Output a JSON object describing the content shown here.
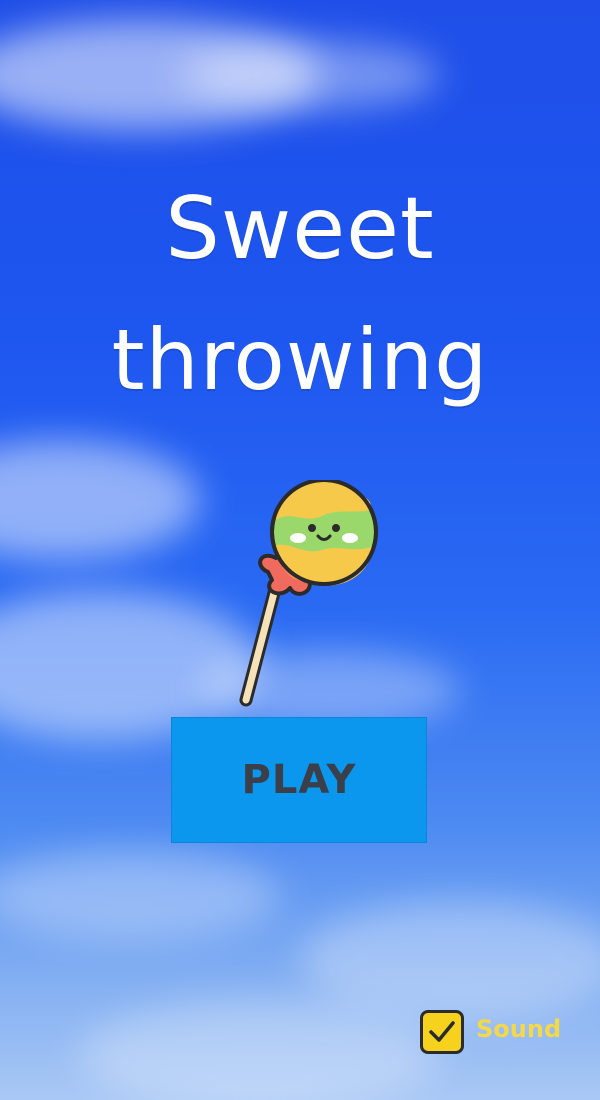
{
  "title": {
    "line1": "Sweet",
    "line2": "throwing"
  },
  "play_button": {
    "label": "PLAY"
  },
  "sound": {
    "label": "Sound",
    "checked": true
  },
  "colors": {
    "play_button": "#0b97ee",
    "sound_checkbox": "#f6d21e",
    "sound_label": "#f3d84a",
    "title_text": "#ffffff"
  },
  "icons": [
    "lollipop-icon",
    "check-icon"
  ]
}
